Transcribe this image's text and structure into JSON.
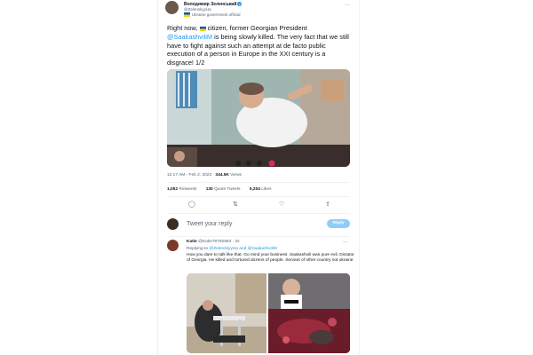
{
  "tweet": {
    "author_name": "Володимир Зеленський",
    "handle": "@ZelenskyyUa",
    "gov_label": "Ukraine government official",
    "text_pre": "Right now,",
    "text_mid1": "citizen, former Georgian President",
    "mention": "@SaakashviliM",
    "text_post": "is being slowly killed. The very fact that we still have to fight against such an attempt at de facto public execution of a person in Europe in the XXI century is a disgrace! 1/2",
    "time": "12:17 AM · Feb 2, 2023 ·",
    "views_count": "344.5K",
    "views_label": "Views"
  },
  "stats": {
    "retweets_count": "1,052",
    "retweets_label": "Retweets",
    "quotes_count": "130",
    "quotes_label": "Quote Tweets",
    "likes_count": "5,204",
    "likes_label": "Likes"
  },
  "compose": {
    "placeholder": "Tweet your reply",
    "button": "Reply"
  },
  "reply": {
    "author_name": "Katie",
    "handle": "@Katie78792963",
    "time": "· 2s",
    "replying_prefix": "Replying to",
    "replying_to": "@ZelenskyyUa and @SaakashviliM",
    "text": "How you dare to talk like that. Go mind your business. Saakashvili was pure evil. Dictator of Georgia. He killed and tortured dozens of people. Servant of other country not ukraine"
  },
  "colors": {
    "accent": "#1d9bf0",
    "muted": "#536471",
    "reply_button": "#8ecdf7"
  },
  "icons": [
    "verified-icon",
    "ukraine-flag-icon",
    "more-icon",
    "reply-icon",
    "retweet-icon",
    "like-icon",
    "share-icon"
  ]
}
